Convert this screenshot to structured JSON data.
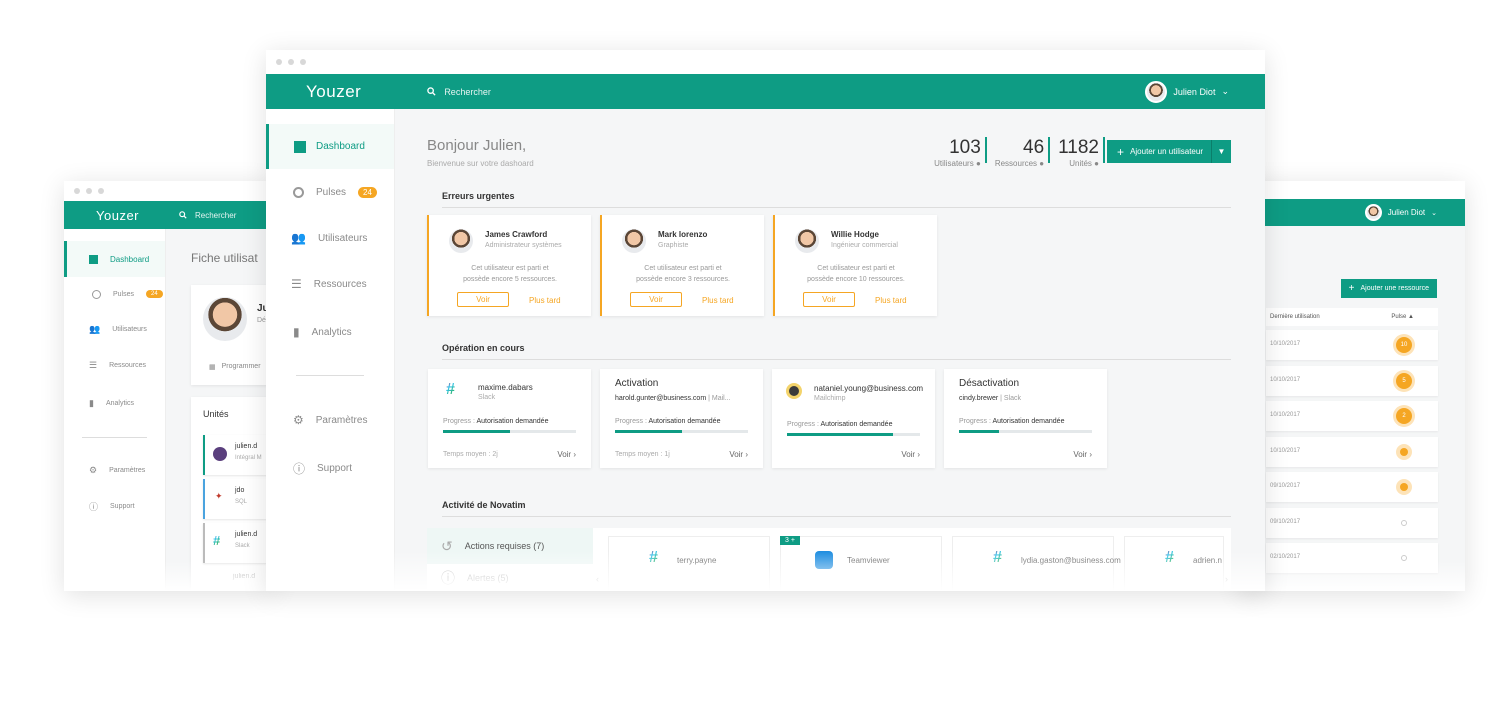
{
  "brand": "Youzer",
  "search_placeholder": "Rechercher",
  "user_name": "Julien Diot",
  "colors": {
    "accent": "#0e9c84",
    "warning": "#f5a623"
  },
  "nav": [
    {
      "label": "Dashboard",
      "icon": "dashboard-icon"
    },
    {
      "label": "Pulses",
      "icon": "pulse-icon",
      "badge": "24"
    },
    {
      "label": "Utilisateurs",
      "icon": "users-icon"
    },
    {
      "label": "Ressources",
      "icon": "resources-icon"
    },
    {
      "label": "Analytics",
      "icon": "analytics-icon"
    },
    {
      "label": "Paramètres",
      "icon": "gear-icon"
    },
    {
      "label": "Support",
      "icon": "help-icon"
    }
  ],
  "main": {
    "greeting": "Bonjour Julien,",
    "subtitle": "Bienvenue sur votre dashoard",
    "stats": [
      {
        "value": "103",
        "label": "Utilisateurs"
      },
      {
        "value": "46",
        "label": "Ressources"
      },
      {
        "value": "1182",
        "label": "Unités"
      }
    ],
    "add_user_label": "Ajouter un utilisateur",
    "errors_title": "Erreurs urgentes",
    "errors": [
      {
        "name": "James Crawford",
        "role": "Administrateur systèmes",
        "msg1": "Cet utilisateur est parti et",
        "msg2": "possède encore 5 ressources.",
        "btn": "Voir",
        "later": "Plus tard"
      },
      {
        "name": "Mark lorenzo",
        "role": "Graphiste",
        "msg1": "Cet utilisateur est parti et",
        "msg2": "possède encore 3 ressources.",
        "btn": "Voir",
        "later": "Plus tard"
      },
      {
        "name": "Willie Hodge",
        "role": "Ingénieur commercial",
        "msg1": "Cet utilisateur est parti et",
        "msg2": "possède encore 10 ressources.",
        "btn": "Voir",
        "later": "Plus tard"
      }
    ],
    "ops_title": "Opération en cours",
    "ops": [
      {
        "title": "maxime.dabars",
        "sub": "Slack",
        "progress_label": "Progress : ",
        "progress_value": "Autorisation demandée",
        "progress": 0.5,
        "time": "Temps moyen : 2j",
        "link": "Voir"
      },
      {
        "title": "Activation",
        "sub": "harold.gunter@business.com",
        "sub2": "Mail...",
        "progress_label": "Progress : ",
        "progress_value": "Autorisation demandée",
        "progress": 0.5,
        "time": "Temps moyen : 1j",
        "link": "Voir"
      },
      {
        "title": "nataniel.young@business.com",
        "sub": "Mailchimp",
        "progress_label": "Progress : ",
        "progress_value": "Autorisation demandée",
        "progress": 0.8,
        "time": "",
        "link": "Voir"
      },
      {
        "title": "Désactivation",
        "sub": "cindy.brewer",
        "sub2": "Slack",
        "progress_label": "Progress : ",
        "progress_value": "Autorisation demandée",
        "progress": 0.3,
        "time": "",
        "link": "Voir"
      }
    ],
    "activity_title": "Activité de Novatim",
    "activity_tabs": [
      "Actions requises (7)",
      "Alertes (5)"
    ],
    "activity_items": [
      "terry.payne",
      "Teamviewer",
      "lydia.gaston@business.com",
      "adrien.n"
    ],
    "activity_badge": "3 +"
  },
  "left_window": {
    "page_title": "Fiche utilisat",
    "profile_initial": "Ju",
    "profile_sub": "Dé",
    "schedule": "Programmer",
    "units_title": "Unités",
    "units": [
      {
        "name": "julien.d",
        "sub": "Intégral M"
      },
      {
        "name": "jdo",
        "sub": "SQL"
      },
      {
        "name": "julien.d",
        "sub": "Slack"
      },
      {
        "name": "julien.d",
        "sub": ""
      }
    ]
  },
  "right_window": {
    "add_resource": "Ajouter une ressource",
    "col_last": "Dernière utilisation",
    "col_pulse": "Pulse",
    "rows": [
      {
        "date": "10/10/2017",
        "pulse": "10"
      },
      {
        "date": "10/10/2017",
        "pulse": "5"
      },
      {
        "date": "10/10/2017",
        "pulse": "2"
      },
      {
        "date": "10/10/2017",
        "pulse": ""
      },
      {
        "date": "09/10/2017",
        "pulse": ""
      },
      {
        "date": "09/10/2017",
        "pulse": ""
      },
      {
        "date": "02/10/2017",
        "pulse": ""
      }
    ]
  }
}
